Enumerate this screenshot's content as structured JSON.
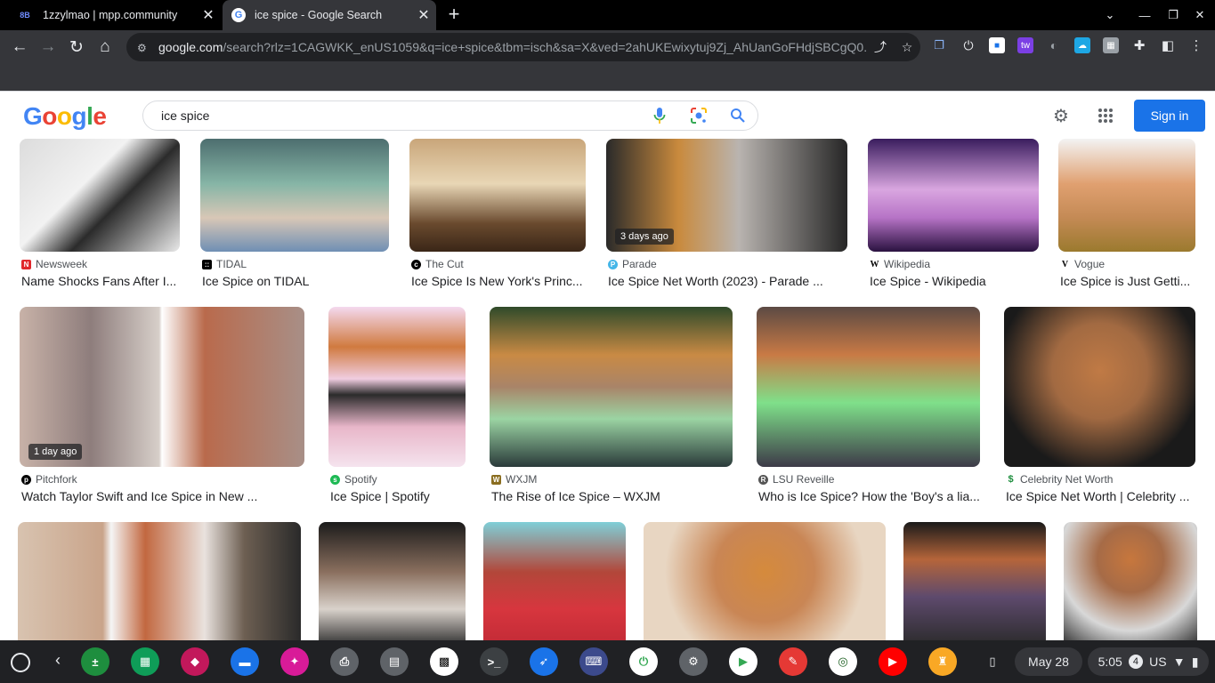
{
  "browser": {
    "tabs": [
      {
        "favicon": "8B",
        "title": "1zzylmao | mpp.community"
      },
      {
        "favicon": "G",
        "title": "ice spice - Google Search"
      }
    ],
    "url_host": "google.com",
    "url_path": "/search?rlz=1CAGWKK_enUS1059&q=ice+spice&tbm=isch&sa=X&ved=2ahUKEwixytuj9Zj_AhUanGoFHdjSBCgQ0..."
  },
  "google": {
    "logo": [
      "G",
      "o",
      "o",
      "g",
      "l",
      "e"
    ],
    "logo_colors": [
      "#4285f4",
      "#ea4335",
      "#fbbc05",
      "#4285f4",
      "#34a853",
      "#ea4335"
    ],
    "query": "ice spice",
    "signin_label": "Sign in"
  },
  "results": [
    {
      "source": "Newsweek",
      "title": "Name Shocks Fans After I...",
      "icon": "N",
      "icon_color": "#e0282c"
    },
    {
      "source": "TIDAL",
      "title": "Ice Spice on TIDAL",
      "icon": "::",
      "icon_color": "#000000"
    },
    {
      "source": "The Cut",
      "title": "Ice Spice Is New York's Princ...",
      "icon": "c",
      "icon_color": "#000000"
    },
    {
      "source": "Parade",
      "title": "Ice Spice Net Worth (2023) - Parade ...",
      "icon": "P",
      "icon_color": "#45b6e8",
      "badge": "3 days ago"
    },
    {
      "source": "Wikipedia",
      "title": "Ice Spice - Wikipedia",
      "icon": "W",
      "icon_color": "#ffffff"
    },
    {
      "source": "Vogue",
      "title": "Ice Spice is Just Getti...",
      "icon": "V",
      "icon_color": "#ffffff"
    },
    {
      "source": "Pitchfork",
      "title": "Watch Taylor Swift and Ice Spice in New ...",
      "icon": "p",
      "icon_color": "#000000",
      "badge": "1 day ago"
    },
    {
      "source": "Spotify",
      "title": "Ice Spice | Spotify",
      "icon": "s",
      "icon_color": "#1db954"
    },
    {
      "source": "WXJM",
      "title": "The Rise of Ice Spice – WXJM",
      "icon": "W",
      "icon_color": "#8a6d1f"
    },
    {
      "source": "LSU Reveille",
      "title": "Who is Ice Spice? How the 'Boy's a lia...",
      "icon": "R",
      "icon_color": "#555555"
    },
    {
      "source": "Celebrity Net Worth",
      "title": "Ice Spice Net Worth | Celebrity ...",
      "icon": "$",
      "icon_color": "#ffffff"
    }
  ],
  "shelf": {
    "date": "May 28",
    "time": "5:05",
    "notifications": "4",
    "locale": "US"
  }
}
